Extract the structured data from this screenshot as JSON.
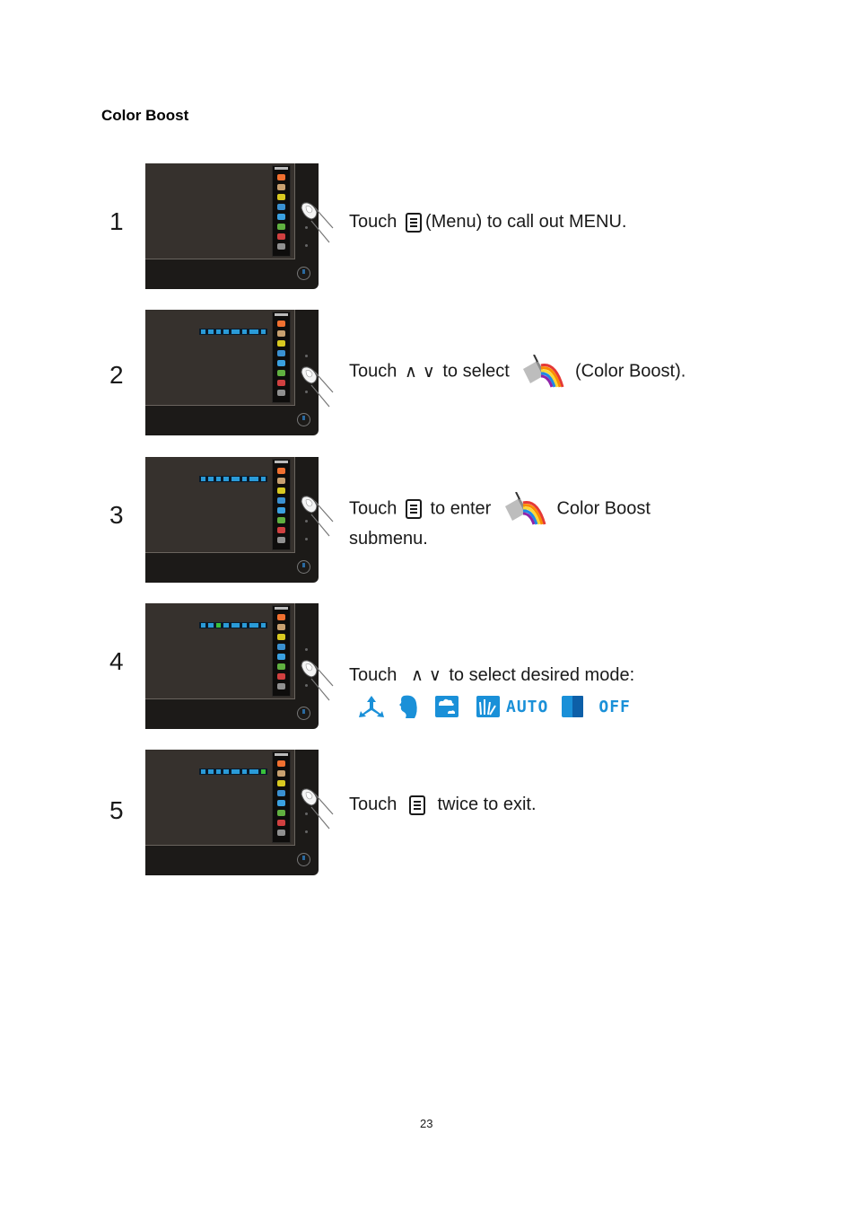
{
  "heading": "Color Boost",
  "steps": [
    {
      "number": "1",
      "parts": [
        "Touch",
        "(Menu) to  call out MENU."
      ]
    },
    {
      "number": "2",
      "parts": [
        "Touch",
        "to select",
        "(Color Boost)."
      ]
    },
    {
      "number": "3",
      "parts": [
        "Touch",
        "to enter",
        "Color Boost",
        "submenu."
      ]
    },
    {
      "number": "4",
      "parts": [
        "Touch",
        "to select desired  mode:"
      ]
    },
    {
      "number": "5",
      "parts": [
        "Touch",
        "twice to exit."
      ]
    }
  ],
  "arrows": {
    "up": "∧",
    "down": "∨"
  },
  "modes": [
    {
      "icon": "full-enhance-icon"
    },
    {
      "icon": "nature-skin-icon"
    },
    {
      "icon": "green-field-icon"
    },
    {
      "icon": "sky-blue-icon"
    },
    {
      "icon": "auto-detect-icon",
      "label": "AUTO"
    },
    {
      "icon": "demo-icon"
    },
    {
      "icon": "off-icon",
      "label": "OFF"
    }
  ],
  "colors": {
    "mode_blue": "#1a90d8"
  },
  "page_number": "23"
}
